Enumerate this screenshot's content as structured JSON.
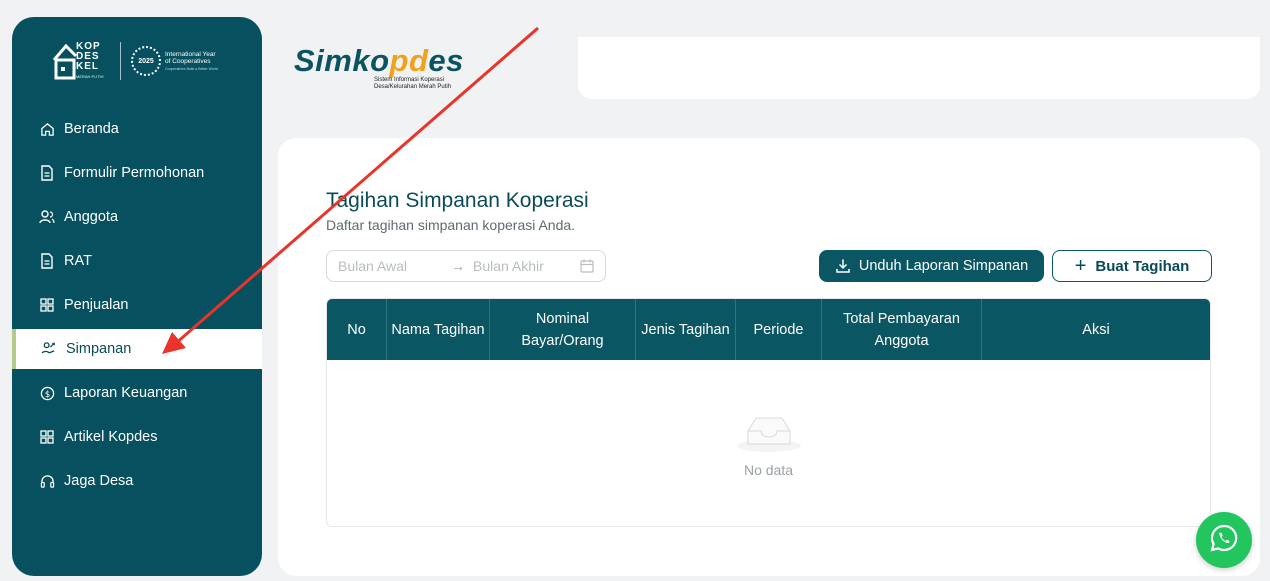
{
  "sidebar": {
    "logo": {
      "mark_text": "KOP\nDES\nKEL",
      "mark_sub": "MERAH PUTIH",
      "coop_year": "2025",
      "coop_text_1": "International Year",
      "coop_text_2": "of Cooperatives",
      "coop_small": "Cooperatives Build a Better World"
    },
    "items": [
      {
        "label": "Beranda",
        "icon": "home-icon"
      },
      {
        "label": "Formulir Permohonan",
        "icon": "document-icon"
      },
      {
        "label": "Anggota",
        "icon": "users-icon"
      },
      {
        "label": "RAT",
        "icon": "document-icon"
      },
      {
        "label": "Penjualan",
        "icon": "grid-icon"
      },
      {
        "label": "Simpanan",
        "icon": "savings-icon"
      },
      {
        "label": "Laporan Keuangan",
        "icon": "dollar-circle-icon"
      },
      {
        "label": "Artikel Kopdes",
        "icon": "grid-icon"
      },
      {
        "label": "Jaga Desa",
        "icon": "headset-icon"
      }
    ],
    "active_index": 5
  },
  "brand": {
    "name_start": "Simko",
    "name_mid": "pd",
    "name_end": "es",
    "tagline": "Sistem Informasi Koperasi\nDesa/Kelurahan Merah Putih"
  },
  "page": {
    "title": "Tagihan Simpanan Koperasi",
    "subtitle": "Daftar tagihan simpanan koperasi Anda.",
    "date_from_placeholder": "Bulan Awal",
    "date_to_placeholder": "Bulan Akhir",
    "download_label": "Unduh Laporan Simpanan",
    "create_label": "Buat Tagihan",
    "table": {
      "headers": [
        "No",
        "Nama Tagihan",
        "Nominal Bayar/Orang",
        "Jenis Tagihan",
        "Periode",
        "Total Pembayaran Anggota",
        "Aksi"
      ],
      "empty_text": "No data"
    }
  },
  "colors": {
    "primary": "#06505f",
    "accent": "#f0a21c",
    "whatsapp": "#22c55e",
    "annotation": "#e8342a"
  }
}
